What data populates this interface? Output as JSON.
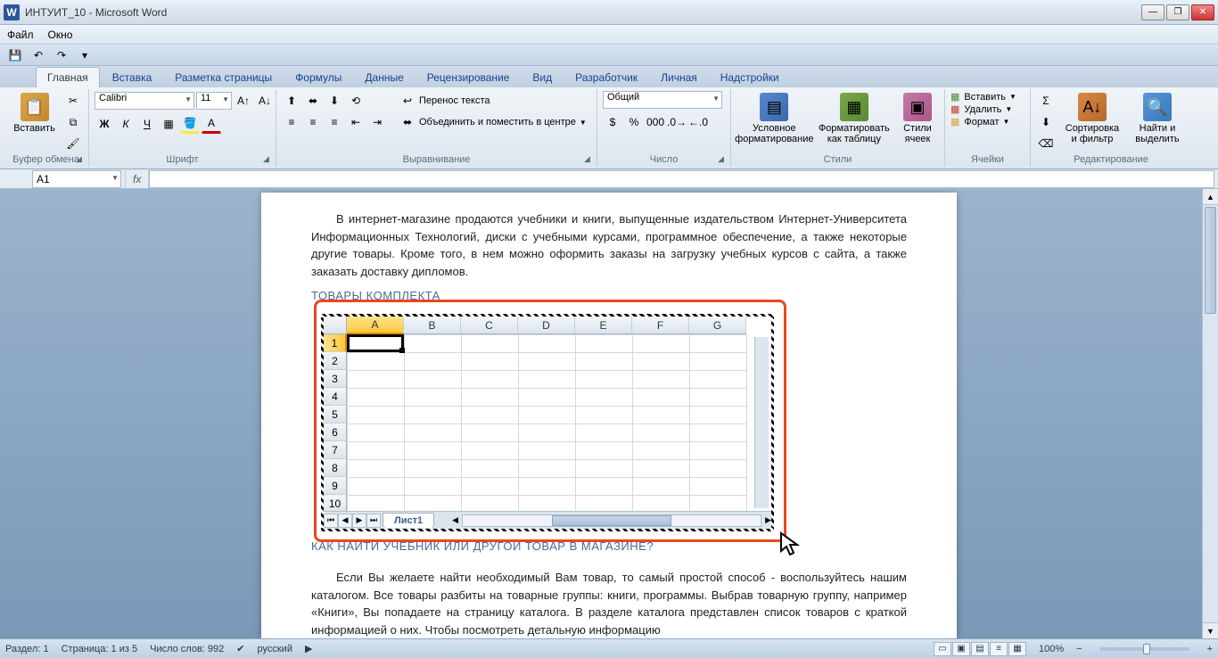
{
  "title": "ИНТУИТ_10 - Microsoft Word",
  "menus": {
    "file": "Файл",
    "window": "Окно"
  },
  "tabs": {
    "home": "Главная",
    "insert": "Вставка",
    "layout": "Разметка страницы",
    "formulas": "Формулы",
    "data": "Данные",
    "review": "Рецензирование",
    "view": "Вид",
    "developer": "Разработчик",
    "personal": "Личная",
    "addins": "Надстройки"
  },
  "ribbon": {
    "clipboard": {
      "label": "Буфер обмена",
      "paste": "Вставить"
    },
    "font": {
      "label": "Шрифт",
      "name": "Calibri",
      "size": "11"
    },
    "alignment": {
      "label": "Выравнивание",
      "wrap": "Перенос текста",
      "merge": "Объединить и поместить в центре"
    },
    "number": {
      "label": "Число",
      "format": "Общий"
    },
    "styles": {
      "label": "Стили",
      "cond": "Условное форматирование",
      "tblfmt": "Форматировать как таблицу",
      "cellsty": "Стили ячеек"
    },
    "cells": {
      "label": "Ячейки",
      "insert": "Вставить",
      "delete": "Удалить",
      "format": "Формат"
    },
    "editing": {
      "label": "Редактирование",
      "sort": "Сортировка и фильтр",
      "find": "Найти и выделить"
    }
  },
  "namebox": "A1",
  "document": {
    "para1": "В интернет-магазине продаются учебники и книги, выпущенные издательством Интернет-Университета Информационных Технологий, диски с учебными курсами, программное обеспечение, а также некоторые другие товары. Кроме того, в нем можно оформить заказы на загрузку учебных курсов с сайта, а также заказать доставку дипломов.",
    "head1": "ТОВАРЫ КОМПЛЕКТА",
    "head2": "КАК НАЙТИ УЧЕБНИК ИЛИ ДРУГОЙ ТОВАР В МАГАЗИНЕ?",
    "para2": "Если Вы желаете найти необходимый Вам товар, то самый простой способ - воспользуйтесь нашим каталогом. Все товары разбиты на товарные группы: книги, программы. Выбрав товарную группу, например «Книги», Вы попадаете на страницу каталога. В разделе каталога представлен список товаров с краткой информацией о них. Чтобы посмотреть детальную информацию"
  },
  "sheet": {
    "cols": [
      "A",
      "B",
      "C",
      "D",
      "E",
      "F",
      "G"
    ],
    "rows": [
      "1",
      "2",
      "3",
      "4",
      "5",
      "6",
      "7",
      "8",
      "9",
      "10"
    ],
    "tab": "Лист1"
  },
  "status": {
    "section": "Раздел: 1",
    "page": "Страница: 1 из 5",
    "words": "Число слов: 992",
    "lang": "русский",
    "zoom": "100%"
  }
}
